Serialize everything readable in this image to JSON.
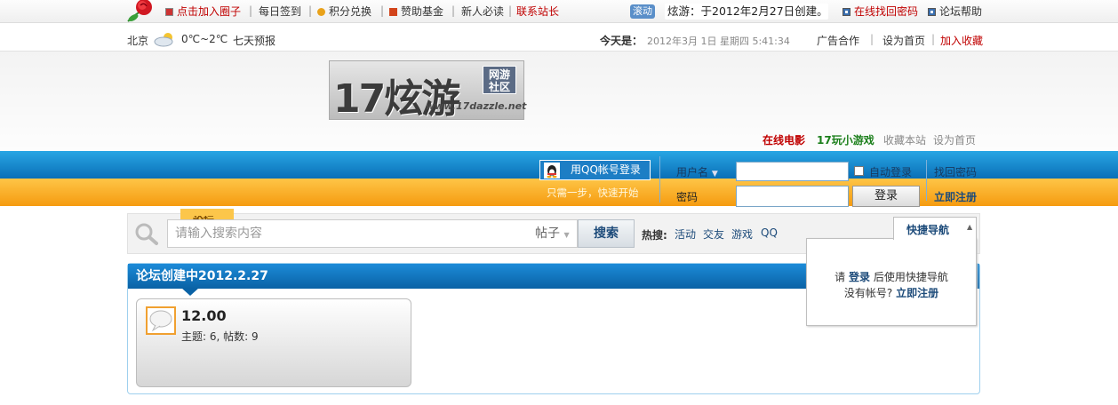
{
  "topbar": {
    "join_circle": "点击加入圈子",
    "daily_checkin": "每日签到",
    "points_exchange": "积分兑换",
    "sponsor_fund": "赞助基金",
    "newbie_read": "新人必读",
    "contact_admin": "联系站长",
    "scroll_badge": "滚动",
    "scroll_text": "炫游：于2012年2月27日创建。",
    "recover_password": "在线找回密码",
    "forum_help": "论坛帮助"
  },
  "subbar": {
    "city": "北京",
    "temperature": "0℃~2℃",
    "forecast": "七天预报",
    "today_label": "今天是：",
    "datetime": "2012年3月 1日 星期四 5:41:34",
    "ad_coop": "广告合作",
    "set_home": "设为首页",
    "add_fav": "加入收藏"
  },
  "logo": {
    "main_text": "17炫游",
    "badge_line1": "网游",
    "badge_line2": "社区",
    "url_text": "www.17dazzle.net"
  },
  "header_links": {
    "online_movie": "在线电影",
    "mini_games": "17玩小游戏",
    "bookmark_site": "收藏本站",
    "set_home": "设为首页"
  },
  "login": {
    "qq_login": "用QQ帐号登录",
    "qq_hint": "只需一步，快速开始",
    "username_label": "用户名",
    "password_label": "密码",
    "auto_login": "自动登录",
    "find_password": "找回密码",
    "login_button": "登录",
    "register_now": "立即注册"
  },
  "search": {
    "placeholder": "请输入搜索内容",
    "type": "帖子",
    "button": "搜索",
    "hot_label": "热搜:",
    "hot_terms": [
      "活动",
      "交友",
      "游戏",
      "QQ"
    ],
    "orange_tab": "论坛"
  },
  "quick_nav": {
    "tab_label": "快捷导航",
    "line1_prefix": "请 ",
    "login_link": "登录",
    "line1_suffix": " 后使用快捷导航",
    "line2_prefix": "没有帐号? ",
    "register_link": "立即注册"
  },
  "forum": {
    "section_title": "论坛创建中2012.2.27",
    "board_name": "12.00",
    "board_stats": "主题: 6, 帖数: 9"
  },
  "colors": {
    "brand_blue": "#0a6fb7",
    "accent_orange": "#f59b10",
    "link_red": "#c00000",
    "link_green": "#1b7f1b",
    "nav_blue": "#1d4b7a"
  }
}
